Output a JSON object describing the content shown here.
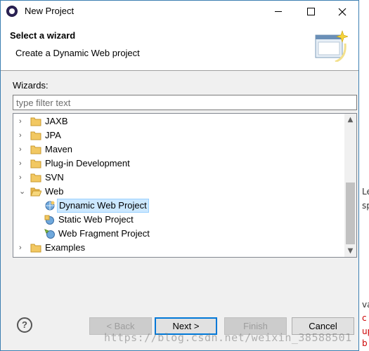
{
  "window": {
    "title": "New Project"
  },
  "header": {
    "title": "Select a wizard",
    "description": "Create a Dynamic Web project"
  },
  "wizards": {
    "label": "Wizards:",
    "filter_placeholder": "type filter text"
  },
  "tree": {
    "items": [
      {
        "label": "JAXB",
        "expanded": false,
        "level": 0,
        "icon": "folder-icon"
      },
      {
        "label": "JPA",
        "expanded": false,
        "level": 0,
        "icon": "folder-icon"
      },
      {
        "label": "Maven",
        "expanded": false,
        "level": 0,
        "icon": "folder-icon"
      },
      {
        "label": "Plug-in Development",
        "expanded": false,
        "level": 0,
        "icon": "folder-icon"
      },
      {
        "label": "SVN",
        "expanded": false,
        "level": 0,
        "icon": "folder-icon"
      },
      {
        "label": "Web",
        "expanded": true,
        "level": 0,
        "icon": "folder-open-icon"
      },
      {
        "label": "Dynamic Web Project",
        "level": 1,
        "selected": true,
        "icon": "dynamic-web-project-icon"
      },
      {
        "label": "Static Web Project",
        "level": 1,
        "icon": "static-web-project-icon"
      },
      {
        "label": "Web Fragment Project",
        "level": 1,
        "icon": "web-fragment-project-icon"
      },
      {
        "label": "Examples",
        "expanded": false,
        "level": 0,
        "icon": "folder-icon"
      }
    ]
  },
  "buttons": {
    "back": "< Back",
    "next": "Next >",
    "finish": "Finish",
    "cancel": "Cancel"
  },
  "watermark": "https://blog.csdn.net/weixin_38588501",
  "background_fragments": [
    "Le",
    "sp",
    "va",
    "c",
    "up",
    "b"
  ],
  "colors": {
    "selection": "#cce8ff",
    "accent": "#0078d7",
    "folder": "#e8b64c"
  }
}
